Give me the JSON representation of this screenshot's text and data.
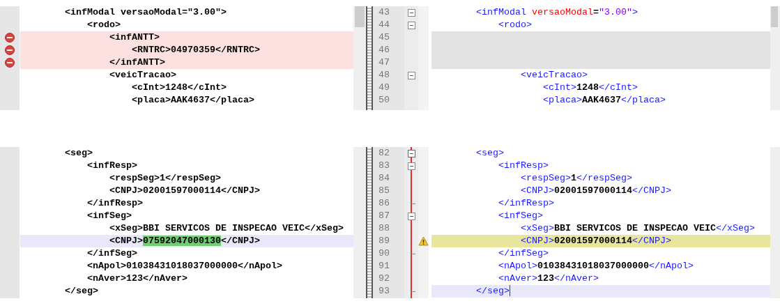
{
  "panes": [
    {
      "fold_range": false,
      "rows": [
        {
          "number": "43",
          "collapsible": true,
          "fold_active": false,
          "fold_end": false,
          "warning": false,
          "left": {
            "text": "        <infModal versaoModal=\"3.00\">",
            "kind": "normal"
          },
          "right": {
            "text": "        <infModal versaoModal=\"3.00\">",
            "kind": "normal"
          }
        },
        {
          "number": "44",
          "collapsible": true,
          "fold_active": false,
          "fold_end": false,
          "warning": false,
          "left": {
            "text": "            <rodo>",
            "kind": "normal"
          },
          "right": {
            "text": "            <rodo>",
            "kind": "normal"
          }
        },
        {
          "number": "45",
          "collapsible": false,
          "fold_end": false,
          "warning": false,
          "left": {
            "text": "                <infANTT>",
            "kind": "deleted"
          },
          "right": {
            "kind": "blank"
          }
        },
        {
          "number": "46",
          "collapsible": false,
          "fold_end": false,
          "warning": false,
          "left": {
            "text": "                    <RNTRC>04970359</RNTRC>",
            "kind": "deleted"
          },
          "right": {
            "kind": "blank"
          }
        },
        {
          "number": "47",
          "collapsible": false,
          "fold_end": false,
          "warning": false,
          "left": {
            "text": "                </infANTT>",
            "kind": "deleted"
          },
          "right": {
            "kind": "blank"
          }
        },
        {
          "number": "48",
          "collapsible": true,
          "fold_active": false,
          "fold_end": false,
          "warning": false,
          "left": {
            "text": "                <veicTracao>",
            "kind": "normal"
          },
          "right": {
            "text": "                <veicTracao>",
            "kind": "normal"
          }
        },
        {
          "number": "49",
          "collapsible": false,
          "fold_end": false,
          "warning": false,
          "left": {
            "text": "                    <cInt>1248</cInt>",
            "kind": "normal"
          },
          "right": {
            "text": "                    <cInt>1248</cInt>",
            "kind": "normal"
          }
        },
        {
          "number": "50",
          "collapsible": false,
          "fold_end": false,
          "warning": false,
          "left": {
            "text": "                    <placa>AAK4637</placa>",
            "kind": "normal"
          },
          "right": {
            "text": "                    <placa>AAK4637</placa>",
            "kind": "normal"
          }
        }
      ]
    },
    {
      "fold_range": true,
      "rows": [
        {
          "number": "82",
          "collapsible": true,
          "fold_active": true,
          "fold_end": false,
          "warning": false,
          "left": {
            "text": "        <seg>",
            "kind": "normal"
          },
          "right": {
            "text": "        <seg>",
            "kind": "normal"
          }
        },
        {
          "number": "83",
          "collapsible": true,
          "fold_active": false,
          "fold_end": false,
          "warning": false,
          "left": {
            "text": "            <infResp>",
            "kind": "normal"
          },
          "right": {
            "text": "            <infResp>",
            "kind": "normal"
          }
        },
        {
          "number": "84",
          "collapsible": false,
          "fold_end": false,
          "warning": false,
          "left": {
            "text": "                <respSeg>1</respSeg>",
            "kind": "normal"
          },
          "right": {
            "text": "                <respSeg>1</respSeg>",
            "kind": "normal"
          }
        },
        {
          "number": "85",
          "collapsible": false,
          "fold_end": false,
          "warning": false,
          "left": {
            "text": "                <CNPJ>02001597000114</CNPJ>",
            "kind": "normal"
          },
          "right": {
            "text": "                <CNPJ>02001597000114</CNPJ>",
            "kind": "normal"
          }
        },
        {
          "number": "86",
          "collapsible": false,
          "fold_end": true,
          "warning": false,
          "left": {
            "text": "            </infResp>",
            "kind": "normal"
          },
          "right": {
            "text": "            </infResp>",
            "kind": "normal"
          }
        },
        {
          "number": "87",
          "collapsible": true,
          "fold_active": false,
          "fold_end": false,
          "warning": false,
          "left": {
            "text": "            <infSeg>",
            "kind": "normal"
          },
          "right": {
            "text": "            <infSeg>",
            "kind": "normal"
          }
        },
        {
          "number": "88",
          "collapsible": false,
          "fold_end": false,
          "warning": false,
          "left": {
            "text": "                <xSeg>BBI SERVICOS DE INSPECAO VEIC</xSeg>",
            "kind": "normal"
          },
          "right": {
            "text": "                <xSeg>BBI SERVICOS DE INSPECAO VEIC</xSeg>",
            "kind": "normal"
          }
        },
        {
          "number": "89",
          "collapsible": false,
          "fold_end": false,
          "warning": true,
          "left": {
            "text": "                <CNPJ>",
            "diff": "07592047000130",
            "after": "</CNPJ>",
            "kind": "current"
          },
          "right": {
            "text": "                <CNPJ>02001597000114</CNPJ>",
            "kind": "changed"
          }
        },
        {
          "number": "90",
          "collapsible": false,
          "fold_end": true,
          "warning": false,
          "left": {
            "text": "            </infSeg>",
            "kind": "normal"
          },
          "right": {
            "text": "            </infSeg>",
            "kind": "normal"
          }
        },
        {
          "number": "91",
          "collapsible": false,
          "fold_end": false,
          "warning": false,
          "left": {
            "text": "            <nApol>01038431018037000000</nApol>",
            "kind": "normal"
          },
          "right": {
            "text": "            <nApol>01038431018037000000</nApol>",
            "kind": "normal"
          }
        },
        {
          "number": "92",
          "collapsible": false,
          "fold_end": false,
          "warning": false,
          "left": {
            "text": "            <nAver>123</nAver>",
            "kind": "normal"
          },
          "right": {
            "text": "            <nAver>123</nAver>",
            "kind": "normal"
          }
        },
        {
          "number": "93",
          "collapsible": false,
          "fold_end": true,
          "warning": false,
          "left": {
            "text": "        </seg>",
            "kind": "normal"
          },
          "right": {
            "text": "        </seg>",
            "kind": "current"
          }
        }
      ]
    }
  ]
}
